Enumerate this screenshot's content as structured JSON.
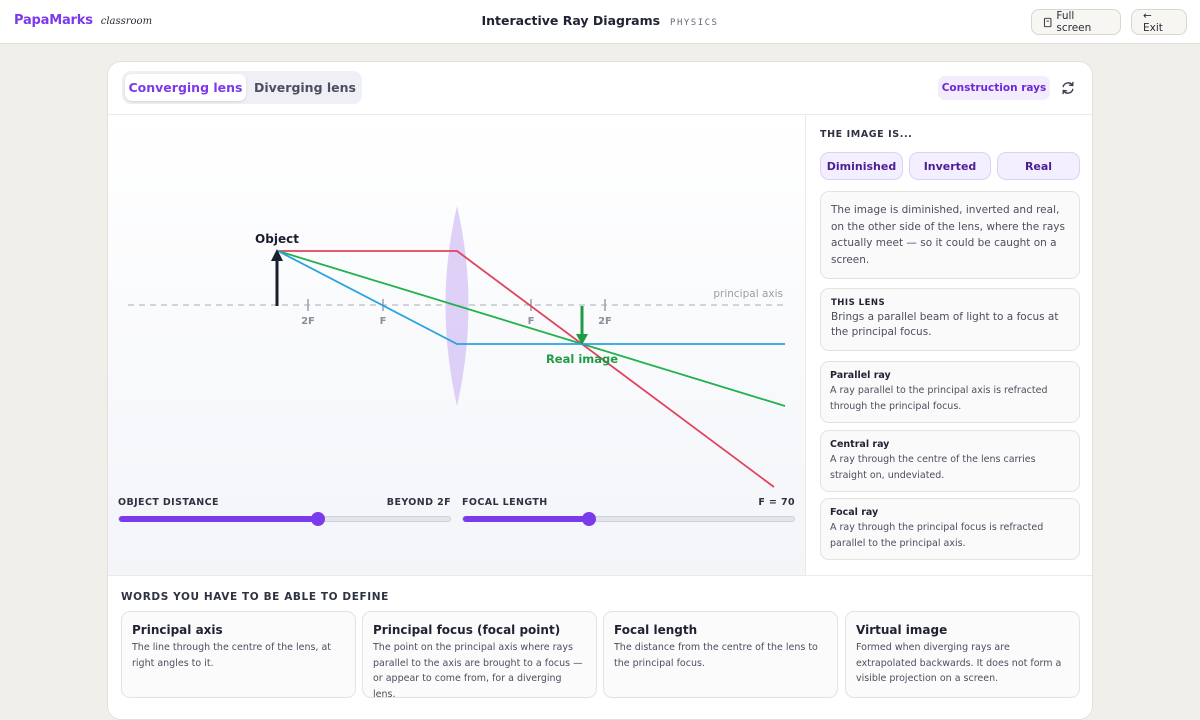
{
  "app": {
    "brand": "PapaMarks",
    "brand_sub": "classroom",
    "title": "Interactive Ray Diagrams",
    "subject": "PHYSICS",
    "fullscreen_label": "Full screen",
    "exit_label": "← Exit"
  },
  "tabs": [
    {
      "label": "Converging lens",
      "active": true
    },
    {
      "label": "Diverging lens",
      "active": false
    }
  ],
  "toolbar": {
    "construction_label": "Construction rays"
  },
  "diagram": {
    "object_label": "Object",
    "image_label": "Real image",
    "axis_label": "principal axis",
    "tick_labels": [
      "2F",
      "F",
      "F",
      "2F"
    ],
    "colors": {
      "parallel_ray": "#e0435e",
      "central_ray": "#22b14c",
      "focal_ray": "#2aa3dd",
      "object_arrow": "#1b1e2e",
      "image_arrow": "#1f9a45",
      "lens": "#d8c8f5",
      "accent": "#7c3aed"
    }
  },
  "sliders": {
    "object_distance": {
      "label": "OBJECT DISTANCE",
      "value_label": "BEYOND 2F",
      "fraction": 0.6
    },
    "focal_length": {
      "label": "FOCAL LENGTH",
      "value_label": "F = 70",
      "fraction": 0.38
    }
  },
  "panel": {
    "heading": "THE IMAGE IS...",
    "chips": [
      "Diminished",
      "Inverted",
      "Real"
    ],
    "description": "The image is diminished, inverted and real, on the other side of the lens, where the rays actually meet — so it could be caught on a screen.",
    "lens_heading": "THIS LENS",
    "lens_text": "Brings a parallel beam of light to a focus at the principal focus.",
    "rays": [
      {
        "title": "Parallel ray",
        "text": "A ray parallel to the principal axis is refracted through the principal focus."
      },
      {
        "title": "Central ray",
        "text": "A ray through the centre of the lens carries straight on, undeviated."
      },
      {
        "title": "Focal ray",
        "text": "A ray through the principal focus is refracted parallel to the principal axis."
      }
    ]
  },
  "definitions": {
    "heading": "WORDS YOU HAVE TO BE ABLE TO DEFINE",
    "items": [
      {
        "term": "Principal axis",
        "definition": "The line through the centre of the lens, at right angles to it."
      },
      {
        "term": "Principal focus (focal point)",
        "definition": "The point on the principal axis where rays parallel to the axis are brought to a focus — or appear to come from, for a diverging lens."
      },
      {
        "term": "Focal length",
        "definition": "The distance from the centre of the lens to the principal focus."
      },
      {
        "term": "Virtual image",
        "definition": "Formed when diverging rays are extrapolated backwards. It does not form a visible projection on a screen."
      }
    ]
  }
}
